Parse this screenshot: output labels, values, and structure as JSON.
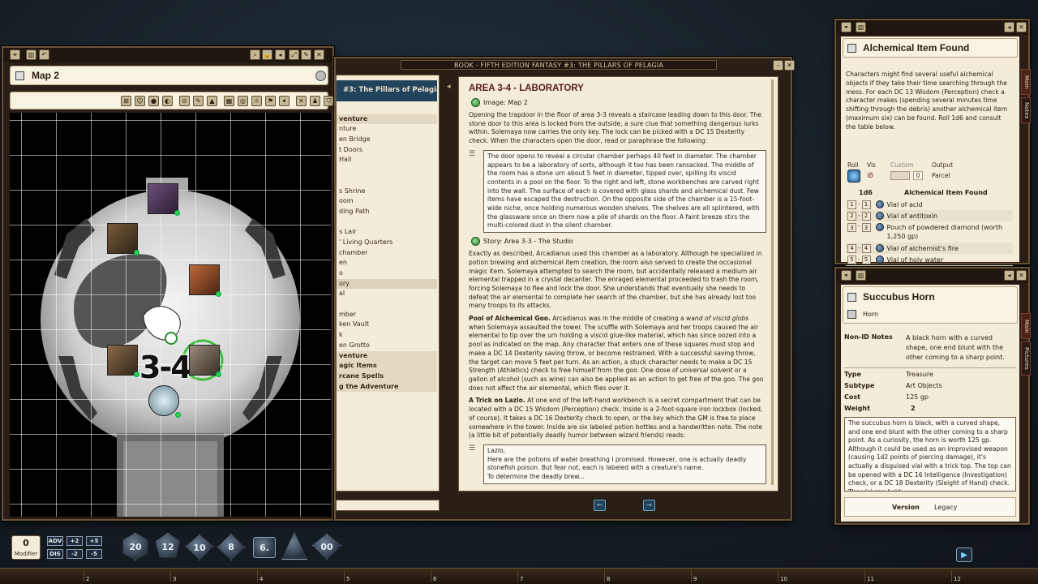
{
  "map_window": {
    "title": "Map 2",
    "map_label": "3-4"
  },
  "book_window": {
    "title": "BOOK - FIFTH EDITION FANTASY #3: THE PILLARS OF PELAGIA",
    "toc_header": "#3: The Pillars of Pelagia",
    "toc_items": [
      {
        "label": "",
        "style": "normal"
      },
      {
        "label": "venture",
        "style": "head"
      },
      {
        "label": "nture",
        "style": "normal"
      },
      {
        "label": "en Bridge",
        "style": "normal"
      },
      {
        "label": "t Doors",
        "style": "normal"
      },
      {
        "label": "Hall",
        "style": "normal"
      },
      {
        "label": "",
        "style": "normal"
      },
      {
        "label": "",
        "style": "normal"
      },
      {
        "label": "s Shrine",
        "style": "normal"
      },
      {
        "label": "oom",
        "style": "normal"
      },
      {
        "label": "ding Path",
        "style": "normal"
      },
      {
        "label": "",
        "style": "normal"
      },
      {
        "label": "s Lair",
        "style": "normal"
      },
      {
        "label": "' Living Quarters",
        "style": "normal"
      },
      {
        "label": "chamber",
        "style": "normal"
      },
      {
        "label": "en",
        "style": "normal"
      },
      {
        "label": "o",
        "style": "normal"
      },
      {
        "label": "ory",
        "style": "sel"
      },
      {
        "label": "al",
        "style": "normal"
      },
      {
        "label": "",
        "style": "normal"
      },
      {
        "label": "mber",
        "style": "normal"
      },
      {
        "label": "ken Vault",
        "style": "normal"
      },
      {
        "label": "k",
        "style": "normal"
      },
      {
        "label": "en Grotto",
        "style": "normal"
      },
      {
        "label": "venture",
        "style": "head"
      },
      {
        "label": "agic Items",
        "style": "head"
      },
      {
        "label": "rcane Spells",
        "style": "head"
      },
      {
        "label": "g the Adventure",
        "style": "head"
      }
    ],
    "heading": "AREA 3-4 - LABORATORY",
    "image_link": "Image: Map 2",
    "intro": "Opening the trapdoor in the floor of area 3-3 reveals a staircase leading down to this door. The stone door to this area is locked from the outside, a sure clue that something dangerous lurks within. Solemaya now carries the only key. The lock can be picked with a DC 15 Dexterity check. When the characters open the door, read or paraphrase the following:",
    "readaloud": "The door opens to reveal a circular chamber perhaps 40 feet in diameter. The chamber appears to be a laboratory of sorts, although it too has been ransacked. The middle of the room has a stone urn about 5 feet in diameter, tipped over, spilling its viscid contents in a pool on the floor. To the right and left, stone workbenches are carved right into the wall. The surface of each is covered with glass shards and alchemical dust. Few items have escaped the destruction. On the opposite side of the chamber is a 15-foot-wide niche, once holding numerous wooden shelves. The shelves are all splintered, with the glassware once on them now a pile of shards on the floor. A faint breeze stirs the multi-colored dust in the silent chamber.",
    "story_link": "Story: Area 3-3 - The Studio",
    "para2": "Exactly as described, Arcadianus used this chamber as a laboratory. Although he specialized in potion brewing and alchemical item creation, the room also served to create the occasional magic item. Solemaya attempted to search the room, but accidentally released a medium air elemental trapped in a crystal decanter. The enraged elemental proceeded to trash the room, forcing Solemaya to flee and lock the door. She understands that eventually she needs to defeat the air elemental to complete her search of the chamber, but she has already lost too many troops to its attacks.",
    "goo_title": "Pool of Alchemical Goo.",
    "goo_a": " Arcadianus was in the middle of creating a ",
    "goo_em1": "wand of viscid globs",
    "goo_b": " when Solemaya assaulted the tower. The scuffle with Solemaya and her troops caused the air elemental to tip over the urn holding a viscid glue-like material, which has since oozed into a pool as indicated on the map. Any character that enters one of these squares must stop and make a DC 14 Dexterity saving throw, or become restrained. With a successful saving throw, the target can move 5 feet per turn. As an action, a stuck character needs to make a DC 15 Strength (Athletics) check to free himself from the goo. One dose of ",
    "goo_em2": "universal solvent",
    "goo_c": " or a gallon of alcohol (such as wine) can also be applied as an action to get free of the goo. The goo does not affect the air elemental, which flies over it.",
    "trick_title": "A Trick on Lazlo.",
    "trick_text": " At one end of the left-hand workbench is a secret compartment that can be located with a DC 15 Wisdom (Perception) check. Inside is a 2-foot-square iron lockbox (locked, of course). It takes a DC 16 Dexterity check to open, or the key which the GM is free to place somewhere in the tower. Inside are six labeled potion bottles and a handwritten note. The note (a little bit of potentially deadly humor between wizard friends) reads:",
    "note_l1": "Lazlo,",
    "note_l2": "Here are the potions of water breathing I promised. However, one is actually deadly stonefish poison. But fear not, each is labeled with a creature's name.",
    "note_l3": "To determine the deadly brew..."
  },
  "table_window": {
    "title": "Alchemical Item Found",
    "description": "Characters might find several useful alchemical objects if they take their time searching through the mess. For each DC 13 Wisdom (Perception) check a character makes (spending several minutes time shifting through the debris) another alchemical item (maximum six) can be found. Roll 1d6 and consult the table below.",
    "hdr_roll": "Roll",
    "hdr_vis": "Vis",
    "hdr_custom": "Custom",
    "custom_value": "0",
    "hdr_output": "Output",
    "output_value": "Parcel",
    "col_dice": "1d6",
    "col_result": "Alchemical Item Found",
    "rows": [
      {
        "from": "1",
        "to": "1",
        "item": "Vial of acid"
      },
      {
        "from": "2",
        "to": "2",
        "item": "Vial of antitoxin"
      },
      {
        "from": "3",
        "to": "3",
        "item": "Pouch of powdered diamond (worth 1,250 gp)"
      },
      {
        "from": "4",
        "to": "4",
        "item": "Vial of alchemist's fire"
      },
      {
        "from": "5",
        "to": "5",
        "item": "Vial of holy water"
      },
      {
        "from": "6",
        "to": "6",
        "item": "Succubus horn"
      }
    ],
    "side_tab_main": "Main",
    "side_tab_notes": "Notes"
  },
  "item_window": {
    "title": "Succubus Horn",
    "subtitle": "Horn",
    "nonid_label": "Non-ID Notes",
    "nonid_value": "A black horn with a curved shape, one end blunt with the other coming to a sharp point.",
    "type_label": "Type",
    "type_value": "Treasure",
    "subtype_label": "Subtype",
    "subtype_value": "Art Objects",
    "cost_label": "Cost",
    "cost_value": "125 gp",
    "weight_label": "Weight",
    "weight_value": "2",
    "description": "The succubus horn is black, with a curved shape, and one end blunt with the other coming to a sharp point. As a curiosity, the horn is worth 125 gp. Although it could be used as an improvised weapon (causing 1d2 points of piercing damage), it's actually a disguised vial with a trick top. The top can be opened with a DC 16 Intelligence (Investigation) check, or a DC 18 Dexterity (Sleight of Hand) check. The vial can hold",
    "version_label": "Version",
    "version_value": "Legacy",
    "side_tab_main": "Main",
    "side_tab_pictures": "Pictures"
  },
  "bottom_bar": {
    "modifier_value": "0",
    "modifier_label": "Modifier",
    "adv": "ADV",
    "dis": "DIS",
    "plus2": "+2",
    "plus5": "+5",
    "minus2": "-2",
    "minus5": "-5",
    "dice": [
      "20",
      "12",
      "10",
      "8",
      "6.",
      "4",
      "00"
    ],
    "hotbar_numbers": [
      "2",
      "3",
      "4",
      "5",
      "6",
      "7",
      "8",
      "9",
      "10",
      "11",
      "12"
    ]
  },
  "colors": {
    "frame": "#6b5336",
    "parchment": "#f3ecd8",
    "heading": "#5a1a12",
    "token_dot": "#2fd14a"
  }
}
